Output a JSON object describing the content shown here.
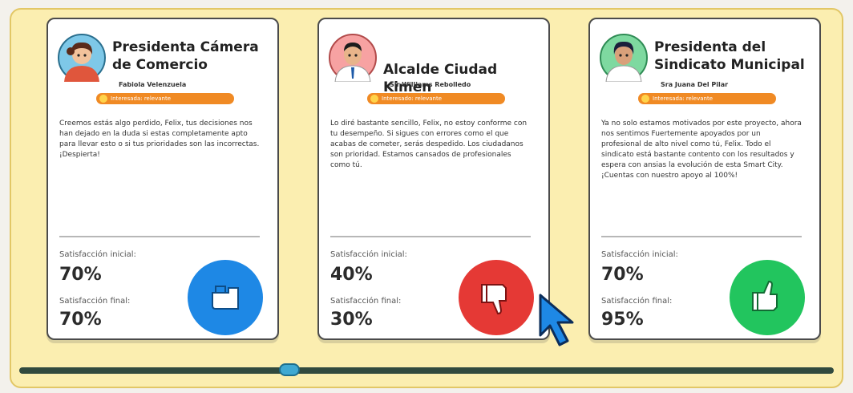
{
  "cards": [
    {
      "role": "Presidenta Cámera de Comercio",
      "person": "Fabiola Velenzuela",
      "tag": "Interesada: relevante",
      "quote": "Creemos estás algo perdido, Felix, tus decisiones nos han dejado en la duda si estas completamente apto para llevar esto o si tus prioridades son las incorrectas. ¡Despierta!",
      "initial_label": "Satisfacción inicial:",
      "initial_value": "70%",
      "final_label": "Satisfacción final:",
      "final_value": "70%",
      "feedback": "neutral",
      "accent": "#1e88e5"
    },
    {
      "role": "Alcalde Ciudad Kimen",
      "person": "Sir Williams Rebolledo",
      "tag": "Interesado: relevante",
      "quote": "Lo diré bastante sencillo, Felix, no estoy conforme con tu desempeño. Si sigues con errores como el que acabas de cometer, serás despedido. Los ciudadanos son prioridad. Estamos cansados de profesionales como tú.",
      "initial_label": "Satisfacción inicial:",
      "initial_value": "40%",
      "final_label": "Satisfacción final:",
      "final_value": "30%",
      "feedback": "negative",
      "accent": "#e53935"
    },
    {
      "role": "Presidenta del Sindicato Municipal",
      "person": "Sra Juana Del Pilar",
      "tag": "Interesada: relevante",
      "quote": "Ya no solo estamos motivados por este proyecto, ahora nos sentimos Fuertemente apoyados por un profesional de alto nivel como tú, Felix. Todo el sindicato está bastante contento con los resultados y espera con ansias la evolución de esta Smart City. ¡Cuentas con nuestro apoyo al 100%!",
      "initial_label": "Satisfacción inicial:",
      "initial_value": "70%",
      "final_label": "Satisfacción final:",
      "final_value": "95%",
      "feedback": "positive",
      "accent": "#22c55e"
    }
  ],
  "slider": {
    "position": 0.33
  }
}
